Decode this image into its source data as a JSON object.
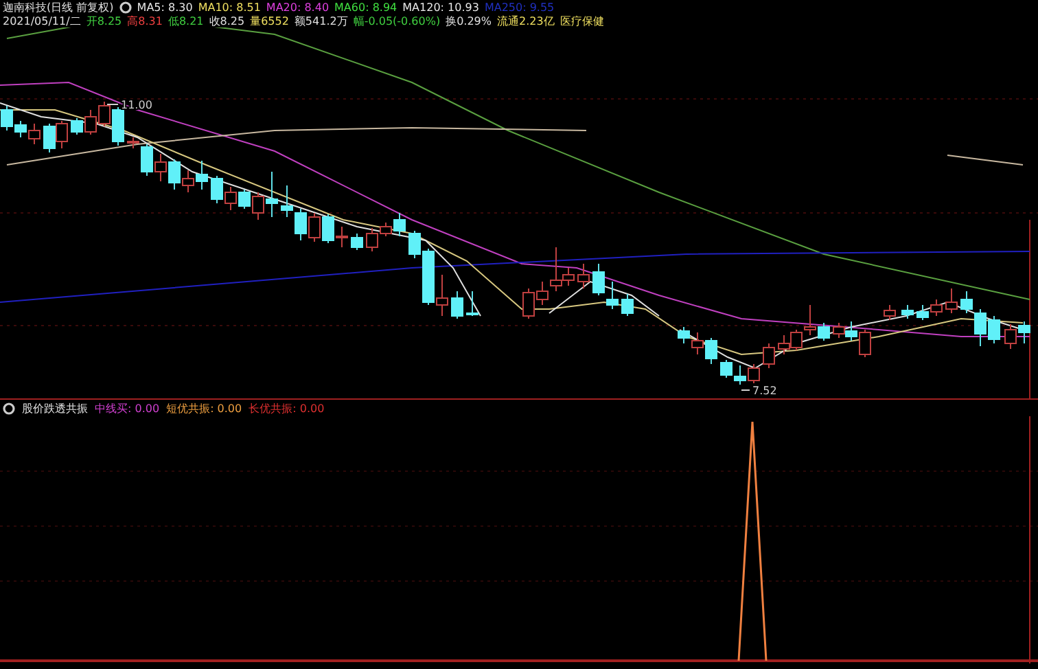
{
  "header": {
    "title": "迦南科技(日线 前复权)",
    "ma": [
      {
        "label": "MA5: 8.30",
        "color": "#e8e8e8"
      },
      {
        "label": "MA10: 8.51",
        "color": "#f0e060"
      },
      {
        "label": "MA20: 8.40",
        "color": "#e040e0"
      },
      {
        "label": "MA60: 8.94",
        "color": "#40e040"
      },
      {
        "label": "MA120: 10.93",
        "color": "#e8e8e8"
      },
      {
        "label": "MA250: 9.55",
        "color": "#2030c0"
      }
    ]
  },
  "quote": [
    {
      "text": "2021/05/11/二",
      "color": "#e0e0e0"
    },
    {
      "text": "开8.25",
      "color": "#40d040"
    },
    {
      "text": "高8.31",
      "color": "#f04040"
    },
    {
      "text": "低8.21",
      "color": "#40d040"
    },
    {
      "text": "收8.25",
      "color": "#e0e0e0"
    },
    {
      "text": "量6552",
      "color": "#f0e060"
    },
    {
      "text": "额541.2万",
      "color": "#e0e0e0"
    },
    {
      "text": "幅-0.05(-0.60%)",
      "color": "#40d040"
    },
    {
      "text": "换0.29%",
      "color": "#e0e0e0"
    },
    {
      "text": "流通2.23亿",
      "color": "#f0e060"
    },
    {
      "text": "医疗保健",
      "color": "#f0e060"
    }
  ],
  "chart": {
    "high_label": "11.00",
    "low_label": "7.52"
  },
  "indicator": {
    "name": "股价跌透共振",
    "values": [
      {
        "text": "中线买: 0.00",
        "color": "#d040d0"
      },
      {
        "text": "短优共振: 0.00",
        "color": "#f0a040"
      },
      {
        "text": "长优共振: 0.00",
        "color": "#e03030"
      }
    ]
  }
}
